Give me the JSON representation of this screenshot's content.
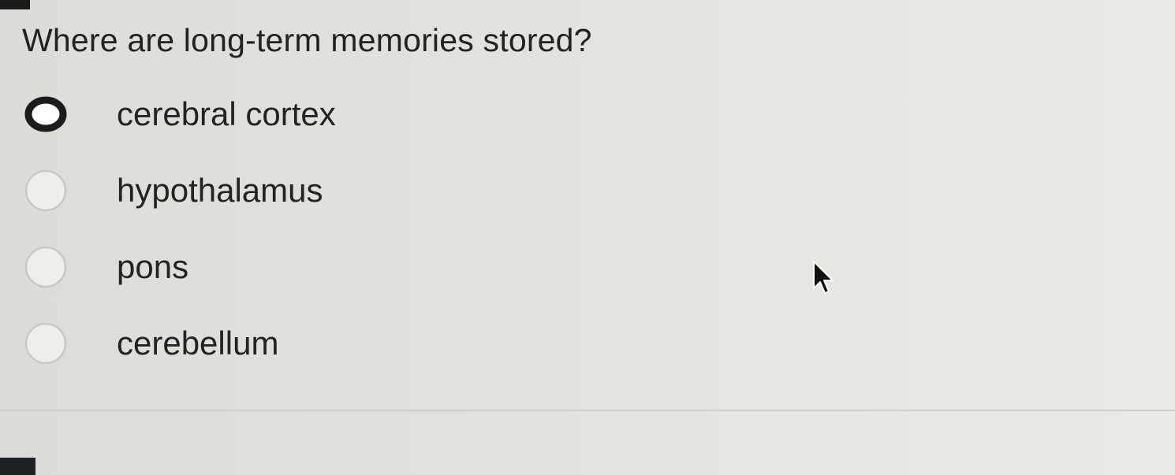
{
  "question": {
    "text": "Where are long-term memories stored?"
  },
  "options": [
    {
      "label": "cerebral cortex",
      "selected": true
    },
    {
      "label": "hypothalamus",
      "selected": false
    },
    {
      "label": "pons",
      "selected": false
    },
    {
      "label": "cerebellum",
      "selected": false
    }
  ],
  "icons": {
    "radio_selected": "radio-selected-icon",
    "radio_unselected": "radio-unselected-icon",
    "cursor": "mouse-pointer-icon"
  },
  "colors": {
    "radio_selected_ring": "#1b1b1b",
    "radio_unselected_ring": "#c9c8c4",
    "text": "#222222"
  }
}
